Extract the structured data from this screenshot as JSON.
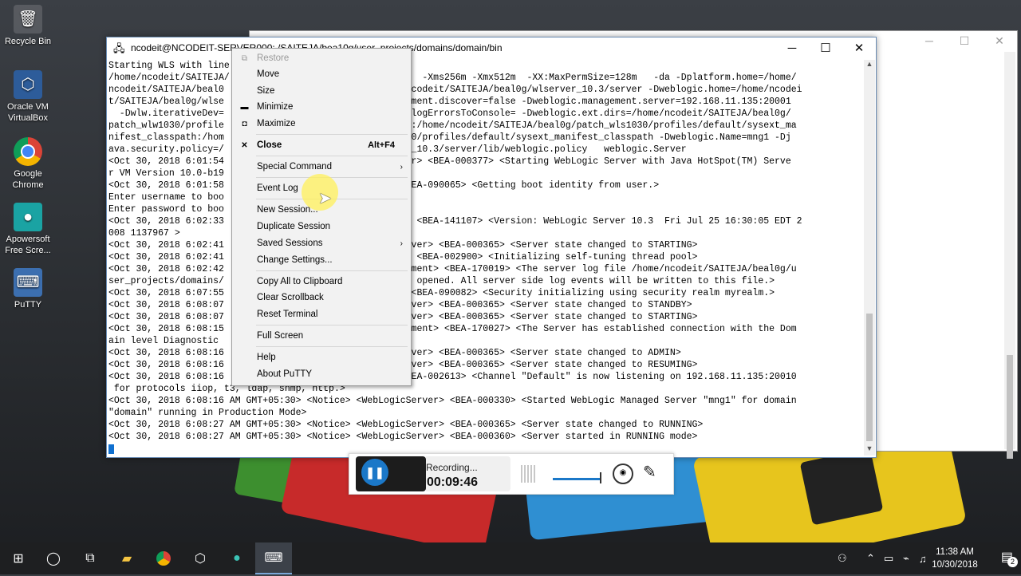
{
  "desktop": {
    "icons": [
      {
        "label": "Recycle Bin",
        "icon": "recycle-bin-icon"
      },
      {
        "label": "Oracle VM VirtualBox",
        "icon": "virtualbox-icon"
      },
      {
        "label": "Google Chrome",
        "icon": "chrome-icon"
      },
      {
        "label": "Apowersoft Free Scre...",
        "icon": "apowersoft-icon"
      },
      {
        "label": "PuTTY",
        "icon": "putty-icon"
      }
    ]
  },
  "bg_window": {
    "lines": [
      "Dplatform.home=/home/",
      "ogic.home=/home/ncodei",
      "ulw.testConsole=false",
      "/sysext_manifest_clas",
      "/SAITEJA/beal0g/patch",
      "ncodeit/SAITEJA/beal0",
      "",
      "Java HotSpot(TM) Serve",
      "",
      "Jul 25 16:30:05 EDT 2",
      "",
      "",
      "",
      "",
      "",
      "",
      "TING>",
      "ool>",
      "odeit/SAITEJA/beal0g/u",
      " be written to this f",
      "",
      "y realm myrealm.>",
      "DBY>",
      "TING>"
    ]
  },
  "window": {
    "title": "ncodeit@NCODEIT-SERVER000: /SAITEJA/bea10g/user_projects/domains/domain/bin",
    "minimize": "─",
    "maximize": "☐",
    "close": "✕",
    "terminal_lines": [
      "Starting WLS with line:",
      "/home/ncodeit/SAITEJA/                           erver   -Xms256m -Xmx512m  -XX:MaxPermSize=128m   -da -Dplatform.home=/home/",
      "ncodeit/SAITEJA/beal0                            home/ncodeit/SAITEJA/beal0g/wlserver_10.3/server -Dweblogic.home=/home/ncodei",
      "t/SAITEJA/beal0g/wlse                            management.discover=false -Dweblogic.management.server=192.168.11.135:20001",
      "  -Dwlw.iterativeDev=                            -Dwlw.logErrorsToConsole= -Dweblogic.ext.dirs=/home/ncodeit/SAITEJA/beal0g/",
      "patch_wlw1030/profile                            gspath:/home/ncodeit/SAITEJA/beal0g/patch_wls1030/profiles/default/sysext_ma",
      "nifest_classpath:/hom                            _cie660/profiles/default/sysext_manifest_classpath -Dweblogic.Name=mng1 -Dj",
      "ava.security.policy=/                            server_10.3/server/lib/weblogic.policy   weblogic.Server",
      "<Oct 30, 2018 6:01:54                            cServer> <BEA-000377> <Starting WebLogic Server with Java HotSpot(TM) Serve",
      "r VM Version 10.0-b19",
      "<Oct 30, 2018 6:01:58                            ty> <BEA-090065> <Getting boot identity from user.>",
      "Enter username to boo",
      "Enter password to boo",
      "<Oct 30, 2018 6:02:33                            ement> <BEA-141107> <Version: WebLogic Server 10.3  Fri Jul 25 16:30:05 EDT 2",
      "008 1137967 >",
      "<Oct 30, 2018 6:02:41                            gicServer> <BEA-000365> <Server state changed to STARTING>",
      "<Oct 30, 2018 6:02:41                            nager> <BEA-002900> <Initializing self-tuning thread pool>",
      "<Oct 30, 2018 6:02:42                            Management> <BEA-170019> <The server log file /home/ncodeit/SAITEJA/beal0g/u",
      "ser_projects/domains/                            log is opened. All server side log events will be written to this file.>",
      "<Oct 30, 2018 6:07:55                            rity> <BEA-090082> <Security initializing using security realm myrealm.>",
      "<Oct 30, 2018 6:08:07                            gicServer> <BEA-000365> <Server state changed to STANDBY>",
      "<Oct 30, 2018 6:08:07                            gicServer> <BEA-000365> <Server state changed to STARTING>",
      "<Oct 30, 2018 6:08:15                            Management> <BEA-170027> <The Server has established connection with the Dom",
      "ain level Diagnostic",
      "<Oct 30, 2018 6:08:16                            gicServer> <BEA-000365> <Server state changed to ADMIN>",
      "<Oct 30, 2018 6:08:16                            gicServer> <BEA-000365> <Server state changed to RESUMING>",
      "<Oct 30, 2018 6:08:16                            er> <BEA-002613> <Channel \"Default\" is now listening on 192.168.11.135:20010",
      " for protocols iiop, t3, ldap, snmp, http.>",
      "<Oct 30, 2018 6:08:16 AM GMT+05:30> <Notice> <WebLogicServer> <BEA-000330> <Started WebLogic Managed Server \"mng1\" for domain",
      "\"domain\" running in Production Mode>",
      "<Oct 30, 2018 6:08:27 AM GMT+05:30> <Notice> <WebLogicServer> <BEA-000365> <Server state changed to RUNNING>",
      "<Oct 30, 2018 6:08:27 AM GMT+05:30> <Notice> <WebLogicServer> <BEA-000360> <Server started in RUNNING mode>"
    ]
  },
  "context_menu": {
    "restore": "Restore",
    "move": "Move",
    "size": "Size",
    "minimize": "Minimize",
    "maximize": "Maximize",
    "close": "Close",
    "close_accel": "Alt+F4",
    "special_command": "Special Command",
    "event_log": "Event Log",
    "new_session": "New Session...",
    "duplicate_session": "Duplicate Session",
    "saved_sessions": "Saved Sessions",
    "change_settings": "Change Settings...",
    "copy_all": "Copy All to Clipboard",
    "clear_scrollback": "Clear Scrollback",
    "reset_terminal": "Reset Terminal",
    "full_screen": "Full Screen",
    "help": "Help",
    "about": "About PuTTY"
  },
  "recorder": {
    "status": "Recording...",
    "time": "00:09:46"
  },
  "taskbar": {
    "time": "11:38 AM",
    "date": "10/30/2018",
    "notifications": "2"
  }
}
